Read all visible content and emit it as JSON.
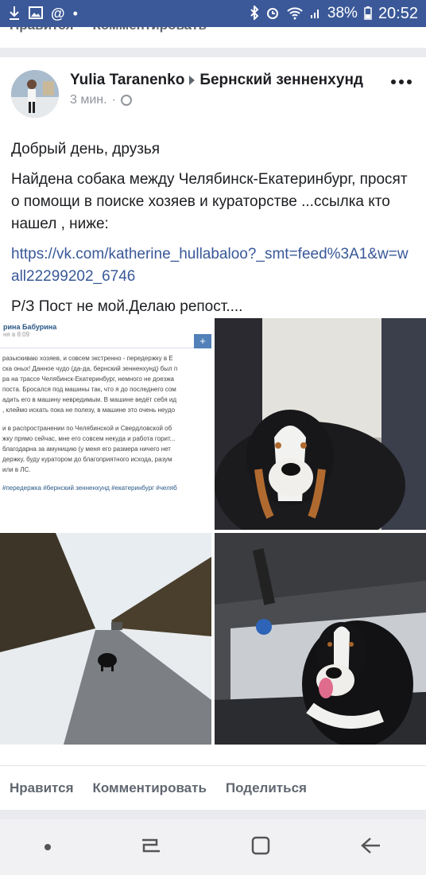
{
  "status_bar": {
    "battery": "38%",
    "time": "20:52",
    "icons": [
      "download-icon",
      "gallery-icon",
      "at-icon",
      "dot-icon",
      "bluetooth-icon",
      "alarm-icon",
      "wifi-icon",
      "signal-icon",
      "battery-icon"
    ]
  },
  "previous_post": {
    "like_label": "Нравится",
    "comment_label": "Комментировать"
  },
  "post": {
    "author": "Yulia Taranenko",
    "group": "Бернский зенненхунд",
    "time": "3 мин.",
    "separator": "·",
    "text_line1": "Добрый день, друзья",
    "text_line2": "Найдена собака между Челябинск-Екатеринбург, просят о помощи в поиске хозяев и кураторстве ...ссылка кто нашел , ниже:",
    "link": "https://vk.com/katherine_hullabaloo?_smt=feed%3A1&w=wall22299202_6746",
    "text_line3": "Р/З Пост не мой.Делаю репост....",
    "screenshot": {
      "name": "рина Бабурина",
      "date": "ня в 8:09",
      "plus": "+",
      "lines": [
        "разыскиваю хозяев, и совсем экстренно - передержку в Е",
        "ска оных! Данное чудо (да-да, бернский зенненхунд) был п",
        "ра на трассе Челябинск-Екатеринбург, немного не доезжа",
        "поста. Бросался под машины так, что я до последнего сом",
        "адить его в машину невредимым. В машине ведёт себя ид",
        ", клеймо искать пока не полезу, в машине это очень неудо"
      ],
      "lines2": [
        "и в распространении по Челябинской и Свердловской об",
        "жку прямо сейчас, мне его совсем некуда и работа горит...",
        "благодарна за амуницию (у меня его размера ничего нет",
        "держку, буду куратором до благоприятного исхода, разум",
        "или в ЛС."
      ],
      "tags": "#передержка #бернский зенненхунд #екатеринбург #челяб"
    },
    "actions": {
      "like": "Нравится",
      "comment": "Комментировать",
      "share": "Поделиться"
    }
  },
  "navigation": {
    "icons": [
      "dot-icon",
      "recent-apps-icon",
      "home-icon",
      "back-icon"
    ]
  }
}
